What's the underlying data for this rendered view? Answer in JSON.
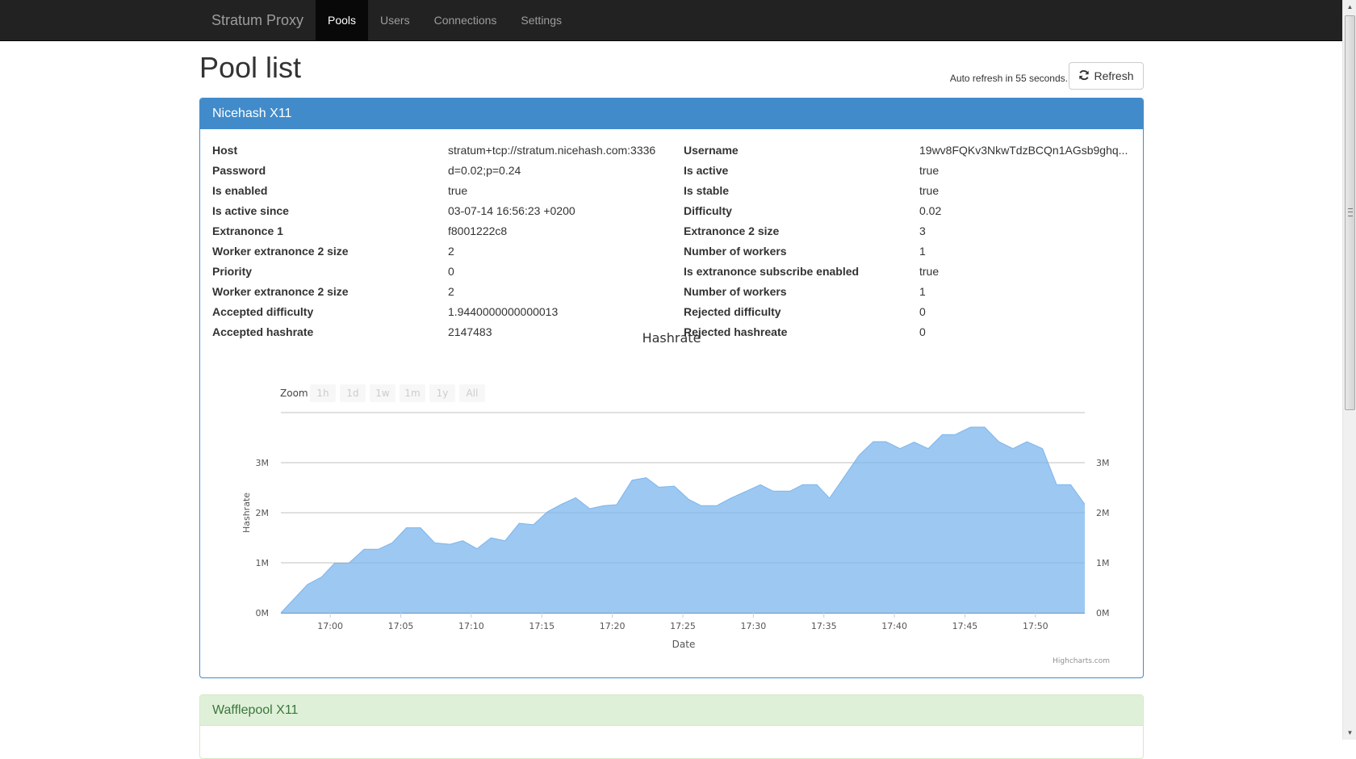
{
  "navbar": {
    "brand": "Stratum Proxy",
    "items": [
      {
        "label": "Pools",
        "active": true
      },
      {
        "label": "Users",
        "active": false
      },
      {
        "label": "Connections",
        "active": false
      },
      {
        "label": "Settings",
        "active": false
      }
    ]
  },
  "page": {
    "title": "Pool list",
    "auto_refresh_text": "Auto refresh in 55 seconds.",
    "refresh_label": "Refresh",
    "refresh_icon": "refresh-icon"
  },
  "pools": [
    {
      "name": "Nicehash X11",
      "style": "primary",
      "properties": [
        {
          "label": "Host",
          "value": "stratum+tcp://stratum.nicehash.com:3336"
        },
        {
          "label": "Username",
          "value": "19wv8FQKv3NkwTdzBCQn1AGsb9ghq..."
        },
        {
          "label": "Password",
          "value": "d=0.02;p=0.24"
        },
        {
          "label": "Is active",
          "value": "true"
        },
        {
          "label": "Is enabled",
          "value": "true"
        },
        {
          "label": "Is stable",
          "value": "true"
        },
        {
          "label": "Is active since",
          "value": "03-07-14 16:56:23 +0200"
        },
        {
          "label": "Difficulty",
          "value": "0.02"
        },
        {
          "label": "Extranonce 1",
          "value": "f8001222c8"
        },
        {
          "label": "Extranonce 2 size",
          "value": "3"
        },
        {
          "label": "Worker extranonce 2 size",
          "value": "2"
        },
        {
          "label": "Number of workers",
          "value": "1"
        },
        {
          "label": "Priority",
          "value": "0"
        },
        {
          "label": "Is extranonce subscribe enabled",
          "value": "true"
        },
        {
          "label": "Worker extranonce 2 size",
          "value": "2"
        },
        {
          "label": "Number of workers",
          "value": "1"
        },
        {
          "label": "Accepted difficulty",
          "value": "1.9440000000000013"
        },
        {
          "label": "Rejected difficulty",
          "value": "0"
        },
        {
          "label": "Accepted hashrate",
          "value": "2147483"
        },
        {
          "label": "Rejected hashreate",
          "value": "0"
        }
      ]
    },
    {
      "name": "Wafflepool X11",
      "style": "success"
    }
  ],
  "chart_data": {
    "type": "area",
    "title": "Hashrate",
    "xlabel": "Date",
    "ylabel": "Hashrate",
    "credits": "Highcharts.com",
    "zoom_label": "Zoom",
    "zoom_buttons": [
      "1h",
      "1d",
      "1w",
      "1m",
      "1y",
      "All"
    ],
    "ylim": [
      0,
      4
    ],
    "yunit": "M",
    "yticks": [
      "0M",
      "1M",
      "2M",
      "3M"
    ],
    "ytick_values": [
      0,
      1,
      2,
      3
    ],
    "grid": true,
    "xlim_minutes": [
      "16:56.5",
      "17:53.5"
    ],
    "xticks": [
      "17:00",
      "17:05",
      "17:10",
      "17:15",
      "17:20",
      "17:25",
      "17:30",
      "17:35",
      "17:40",
      "17:45",
      "17:50"
    ],
    "series": [
      {
        "name": "Hashrate",
        "color": "#7cb5ec",
        "x": [
          "16:56.5",
          "16:58.4",
          "16:59.4",
          "17:00.3",
          "17:01.3",
          "17:02.4",
          "17:03.4",
          "17:04.4",
          "17:05.4",
          "17:06.4",
          "17:07.4",
          "17:08.5",
          "17:09.4",
          "17:10.4",
          "17:11.4",
          "17:12.4",
          "17:13.4",
          "17:14.4",
          "17:15.4",
          "17:16.4",
          "17:17.4",
          "17:18.4",
          "17:19.4",
          "17:20.3",
          "17:21.4",
          "17:22.4",
          "17:23.3",
          "17:24.4",
          "17:25.4",
          "17:26.3",
          "17:27.4",
          "17:28.4",
          "17:29.5",
          "17:30.5",
          "17:31.4",
          "17:32.6",
          "17:33.5",
          "17:34.5",
          "17:35.4",
          "17:36.5",
          "17:37.5",
          "17:38.5",
          "17:39.4",
          "17:40.4",
          "17:41.4",
          "17:42.4",
          "17:43.4",
          "17:44.3",
          "17:45.4",
          "17:46.4",
          "17:47.4",
          "17:48.4",
          "17:49.4",
          "17:50.5",
          "17:51.5",
          "17:52.5",
          "17:53.5"
        ],
        "values": [
          0,
          0.57,
          0.72,
          0.99,
          0.99,
          1.27,
          1.27,
          1.4,
          1.7,
          1.7,
          1.4,
          1.37,
          1.44,
          1.28,
          1.5,
          1.44,
          1.79,
          1.76,
          2.02,
          2.17,
          2.3,
          2.08,
          2.14,
          2.16,
          2.65,
          2.7,
          2.51,
          2.53,
          2.27,
          2.14,
          2.14,
          2.29,
          2.43,
          2.56,
          2.43,
          2.43,
          2.56,
          2.56,
          2.29,
          2.74,
          3.15,
          3.42,
          3.42,
          3.28,
          3.41,
          3.28,
          3.56,
          3.56,
          3.71,
          3.71,
          3.42,
          3.28,
          3.42,
          3.28,
          2.56,
          2.56,
          2.17
        ]
      }
    ]
  }
}
